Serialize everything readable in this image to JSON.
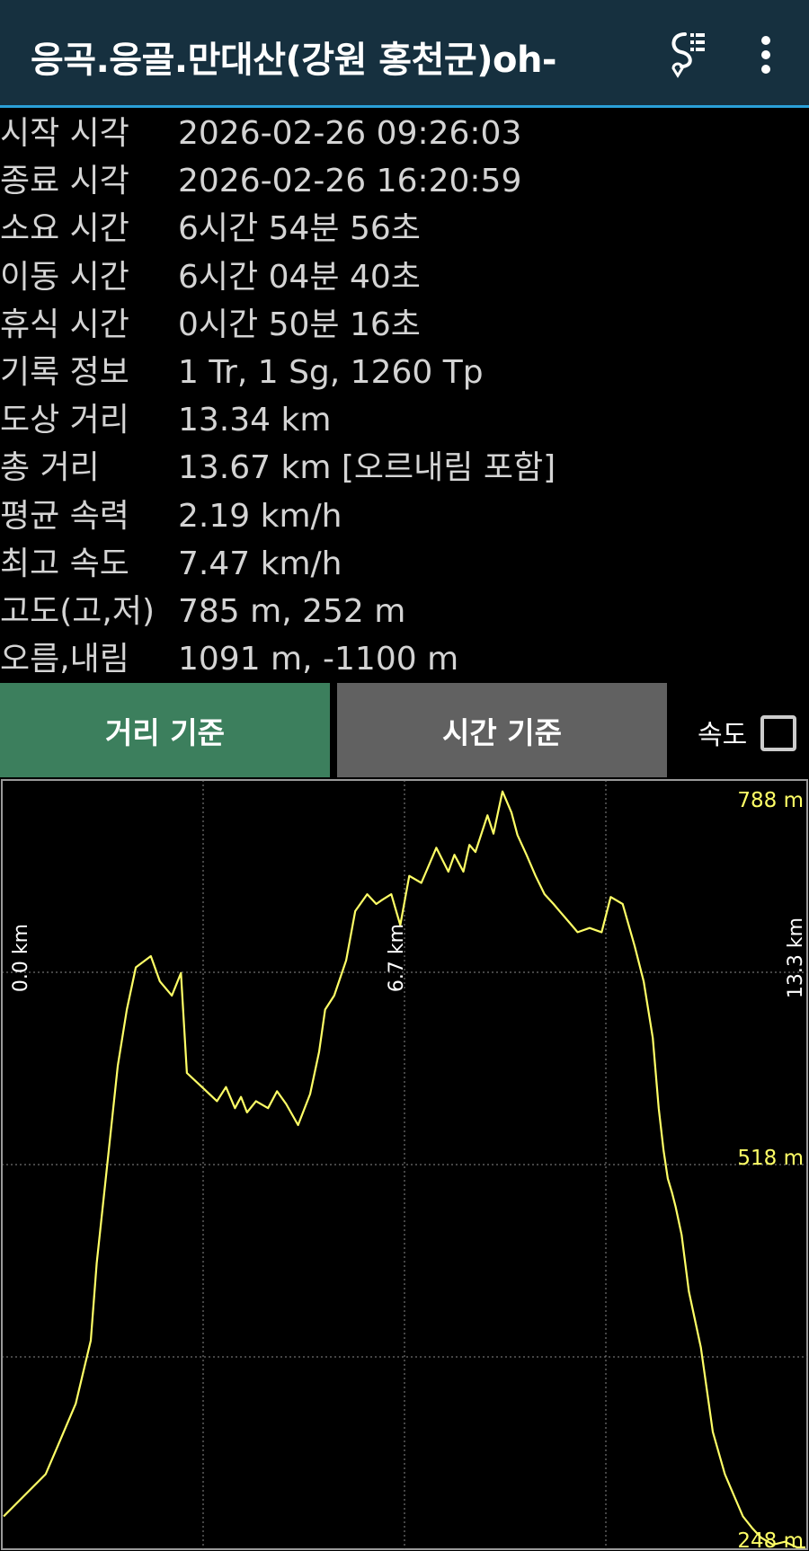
{
  "app_bar": {
    "title": "응곡.응골.만대산(강원 홍천군)oh-",
    "icons": {
      "route": "route-list-icon",
      "menu": "more-vert-icon"
    }
  },
  "stats": [
    {
      "label": "시작 시각",
      "value": "2026-02-26 09:26:03"
    },
    {
      "label": "종료 시각",
      "value": "2026-02-26 16:20:59"
    },
    {
      "label": "소요 시간",
      "value": "6시간 54분 56초"
    },
    {
      "label": "이동 시간",
      "value": "6시간 04분 40초"
    },
    {
      "label": "휴식 시간",
      "value": "0시간 50분 16초"
    },
    {
      "label": "기록 정보",
      "value": "1 Tr, 1 Sg, 1260 Tp"
    },
    {
      "label": "도상 거리",
      "value": "13.34 km"
    },
    {
      "label": "총 거리",
      "value": "13.67 km [오르내림 포함]"
    },
    {
      "label": "평균 속력",
      "value": "2.19 km/h"
    },
    {
      "label": "최고 속도",
      "value": "7.47 km/h"
    },
    {
      "label": "고도(고,저)",
      "value": "785 m, 252 m"
    },
    {
      "label": "오름,내림",
      "value": "1091 m, -1100 m"
    }
  ],
  "tabs": {
    "distance_label": "거리 기준",
    "time_label": "시간 기준",
    "active": "distance"
  },
  "speed_toggle": {
    "label": "속도",
    "checked": false
  },
  "colors": {
    "appbar_bg": "#16303f",
    "appbar_accent": "#2aa0d8",
    "active_tab": "#3c7f5d",
    "inactive_tab": "#616161",
    "line": "#ffff66",
    "tick_label": "#ffff66"
  },
  "chart_data": {
    "type": "line",
    "title": "",
    "xlabel": "",
    "ylabel": "",
    "x_unit": "km",
    "y_unit": "m",
    "xlim": [
      0,
      13.34
    ],
    "ylim": [
      248,
      788
    ],
    "x_tick_labels": [
      "0.0 km",
      "6.7 km",
      "13.3 km"
    ],
    "y_tick_labels": [
      "788 m",
      "518 m",
      "248 m"
    ],
    "grid": true,
    "series": [
      {
        "x": [
          0,
          0.35,
          0.7,
          0.9,
          1.2,
          1.45,
          1.55,
          1.75,
          1.9,
          2.05,
          2.2,
          2.45,
          2.6,
          2.8,
          2.95,
          3.05,
          3.3,
          3.55,
          3.7,
          3.85,
          3.95,
          4.05,
          4.2,
          4.4,
          4.55,
          4.7,
          4.9,
          5.1,
          5.25,
          5.35,
          5.5,
          5.7,
          5.85,
          6.05,
          6.2,
          6.3,
          6.45,
          6.6,
          6.75,
          6.95,
          7.05,
          7.2,
          7.4,
          7.5,
          7.65,
          7.75,
          7.85,
          8.05,
          8.15,
          8.3,
          8.45,
          8.55,
          8.7,
          8.85,
          9.0,
          9.15,
          9.25,
          9.45,
          9.55,
          9.75,
          9.95,
          10.1,
          10.3,
          10.5,
          10.65,
          10.8,
          10.9,
          10.98,
          11.05,
          11.12,
          11.18,
          11.28,
          11.4,
          11.6,
          11.8,
          12.0,
          12.15,
          12.3,
          12.45,
          12.6,
          12.8,
          13.0,
          13.2,
          13.34
        ],
        "y": [
          270,
          285,
          300,
          320,
          350,
          395,
          450,
          530,
          590,
          630,
          660,
          668,
          650,
          640,
          656,
          585,
          575,
          565,
          575,
          560,
          568,
          557,
          565,
          560,
          572,
          563,
          548,
          570,
          600,
          630,
          640,
          665,
          700,
          712,
          705,
          708,
          712,
          690,
          725,
          720,
          730,
          745,
          728,
          740,
          728,
          747,
          742,
          768,
          755,
          785,
          770,
          754,
          740,
          725,
          712,
          705,
          700,
          690,
          685,
          688,
          685,
          710,
          705,
          675,
          650,
          610,
          560,
          530,
          510,
          500,
          490,
          470,
          430,
          390,
          330,
          300,
          285,
          270,
          262,
          255,
          250,
          252,
          248,
          248
        ]
      }
    ]
  }
}
